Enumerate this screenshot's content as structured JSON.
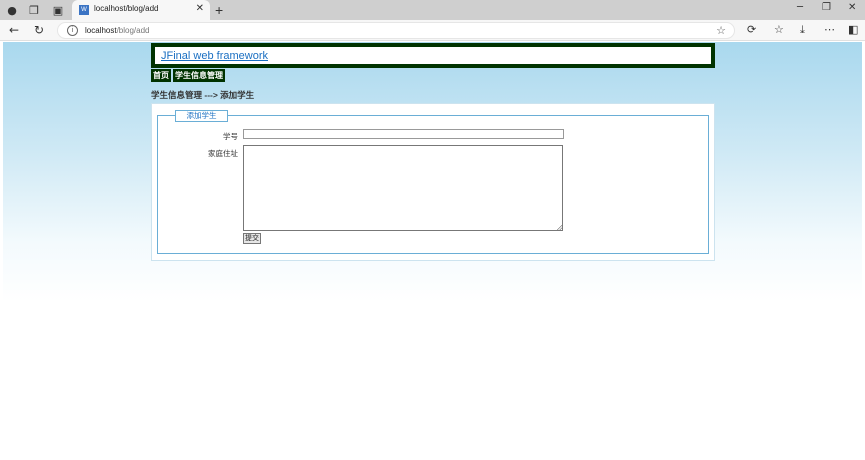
{
  "browser": {
    "tab_title": "localhost/blog/add",
    "url_host": "localhost",
    "url_path": "/blog/add"
  },
  "page": {
    "site_title": "JFinal web framework",
    "menu": [
      {
        "label": "首页"
      },
      {
        "label": "学生信息管理"
      }
    ],
    "breadcrumb": "学生信息管理 ---> 添加学生",
    "form": {
      "legend": "添加学生",
      "student_id_label": "学号",
      "student_id_value": "",
      "address_label": "家庭住址",
      "address_value": "",
      "submit_label": "提交"
    }
  }
}
